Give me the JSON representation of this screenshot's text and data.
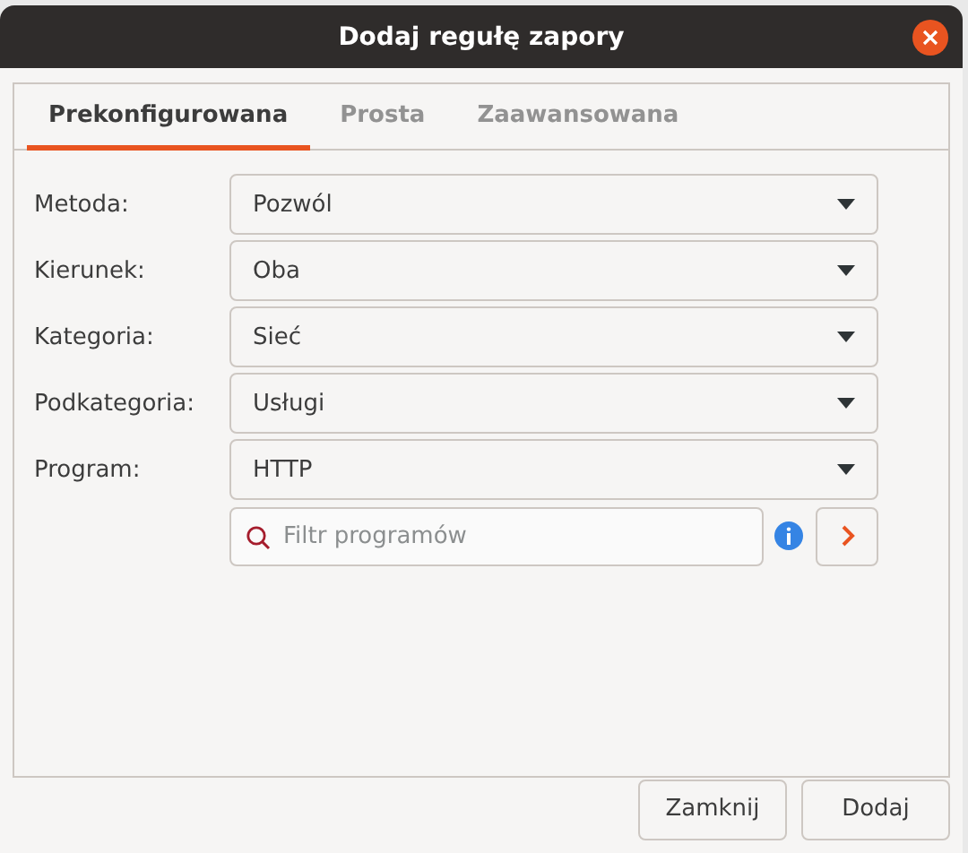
{
  "window": {
    "title": "Dodaj regułę zapory"
  },
  "tabs": [
    {
      "label": "Prekonfigurowana",
      "selected": true
    },
    {
      "label": "Prosta",
      "selected": false
    },
    {
      "label": "Zaawansowana",
      "selected": false
    }
  ],
  "fields": [
    {
      "label": "Metoda:",
      "value": "Pozwól"
    },
    {
      "label": "Kierunek:",
      "value": "Oba"
    },
    {
      "label": "Kategoria:",
      "value": "Sieć"
    },
    {
      "label": "Podkategoria:",
      "value": "Usługi"
    },
    {
      "label": "Program:",
      "value": "HTTP"
    }
  ],
  "filter": {
    "placeholder": "Filtr programów"
  },
  "buttons": [
    "Zamknij",
    "Dodaj"
  ]
}
